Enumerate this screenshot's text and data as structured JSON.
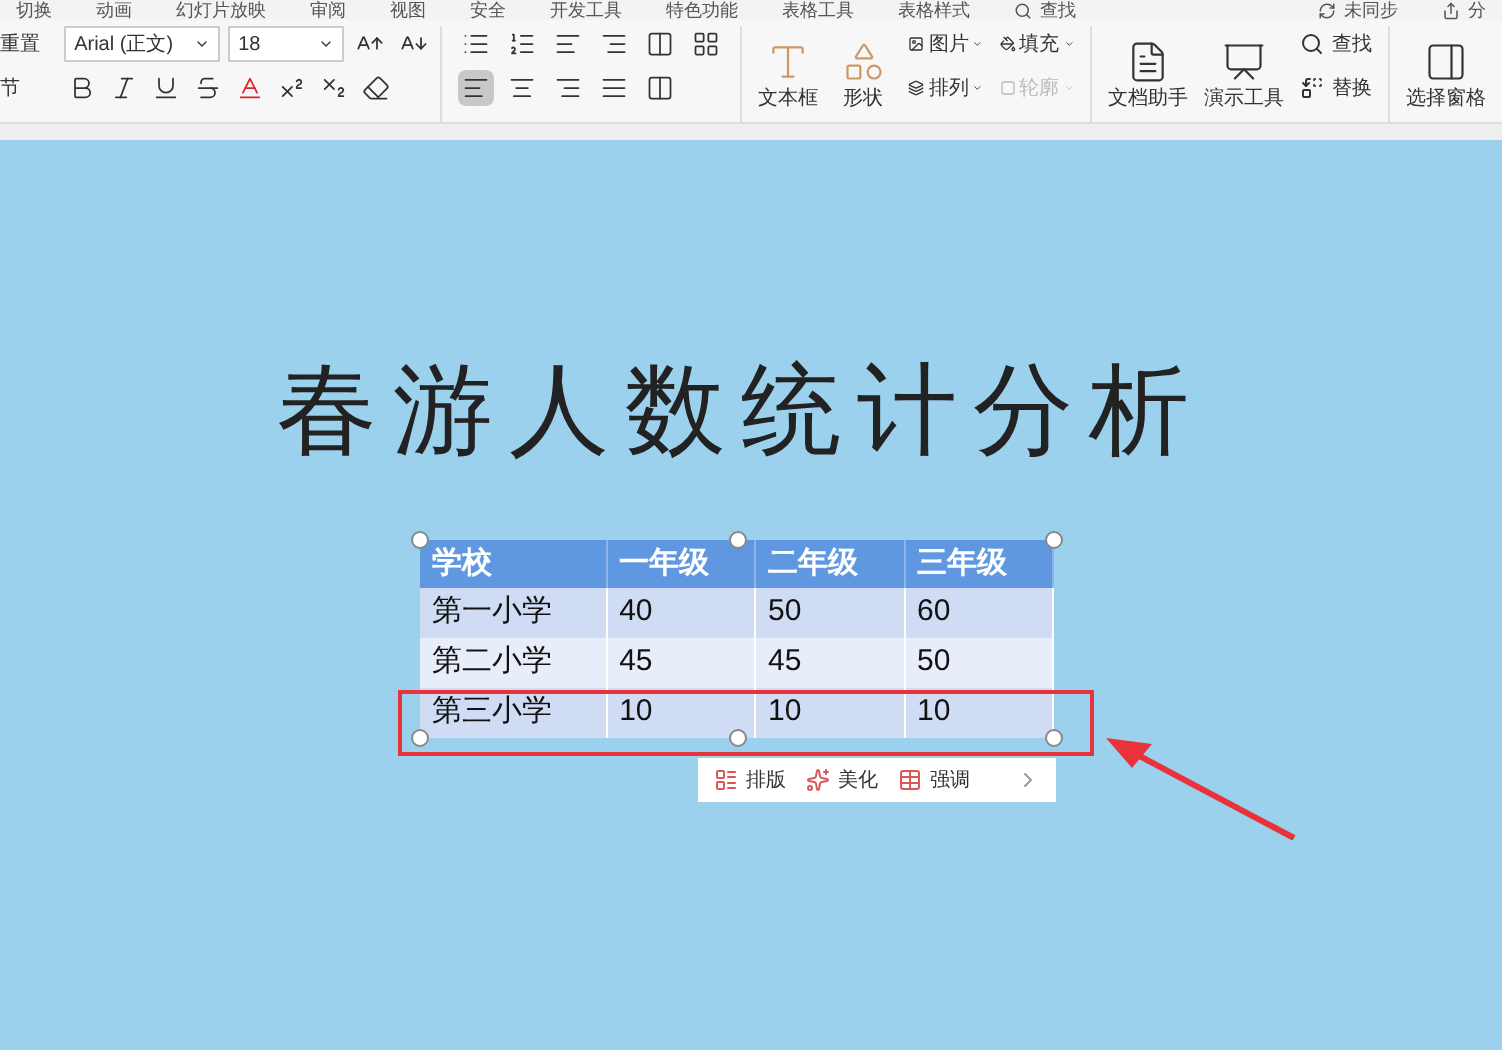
{
  "menu_tabs": [
    "切换",
    "动画",
    "幻灯片放映",
    "审阅",
    "视图",
    "安全",
    "开发工具",
    "特色功能",
    "表格工具",
    "表格样式"
  ],
  "search": {
    "label": "查找"
  },
  "sync": {
    "label": "未同步",
    "share": "分"
  },
  "ribbon": {
    "left_items": [
      "重置",
      "节"
    ],
    "font_name": "Arial (正文)",
    "font_size": "18",
    "alignments": [
      {
        "kind": "left",
        "selected": true
      },
      {
        "kind": "center",
        "selected": false
      },
      {
        "kind": "right",
        "selected": false
      },
      {
        "kind": "justify",
        "selected": false
      },
      {
        "kind": "distribute",
        "selected": false
      }
    ],
    "insert_large": [
      {
        "label": "文本框",
        "kind": "textbox"
      },
      {
        "label": "形状",
        "kind": "shape"
      }
    ],
    "insert_small": [
      {
        "label": "图片",
        "kind": "image",
        "disabled": false
      },
      {
        "label": "填充",
        "kind": "fill",
        "disabled": false
      },
      {
        "label": "排列",
        "kind": "arrange",
        "disabled": false
      },
      {
        "label": "轮廓",
        "kind": "outline",
        "disabled": true
      }
    ],
    "tools": [
      {
        "label": "文档助手",
        "kind": "doc"
      },
      {
        "label": "演示工具",
        "kind": "present"
      }
    ],
    "find": "查找",
    "replace": "替换",
    "pane": "选择窗格"
  },
  "slide": {
    "title": "春游人数统计分析",
    "table": {
      "columns": [
        "学校",
        "一年级",
        "二年级",
        "三年级"
      ],
      "rows": [
        [
          "第一小学",
          "40",
          "50",
          "60"
        ],
        [
          "第二小学",
          "45",
          "45",
          "50"
        ],
        [
          "第三小学",
          "10",
          "10",
          "10"
        ]
      ]
    },
    "float_toolbar": [
      "排版",
      "美化",
      "强调"
    ]
  }
}
